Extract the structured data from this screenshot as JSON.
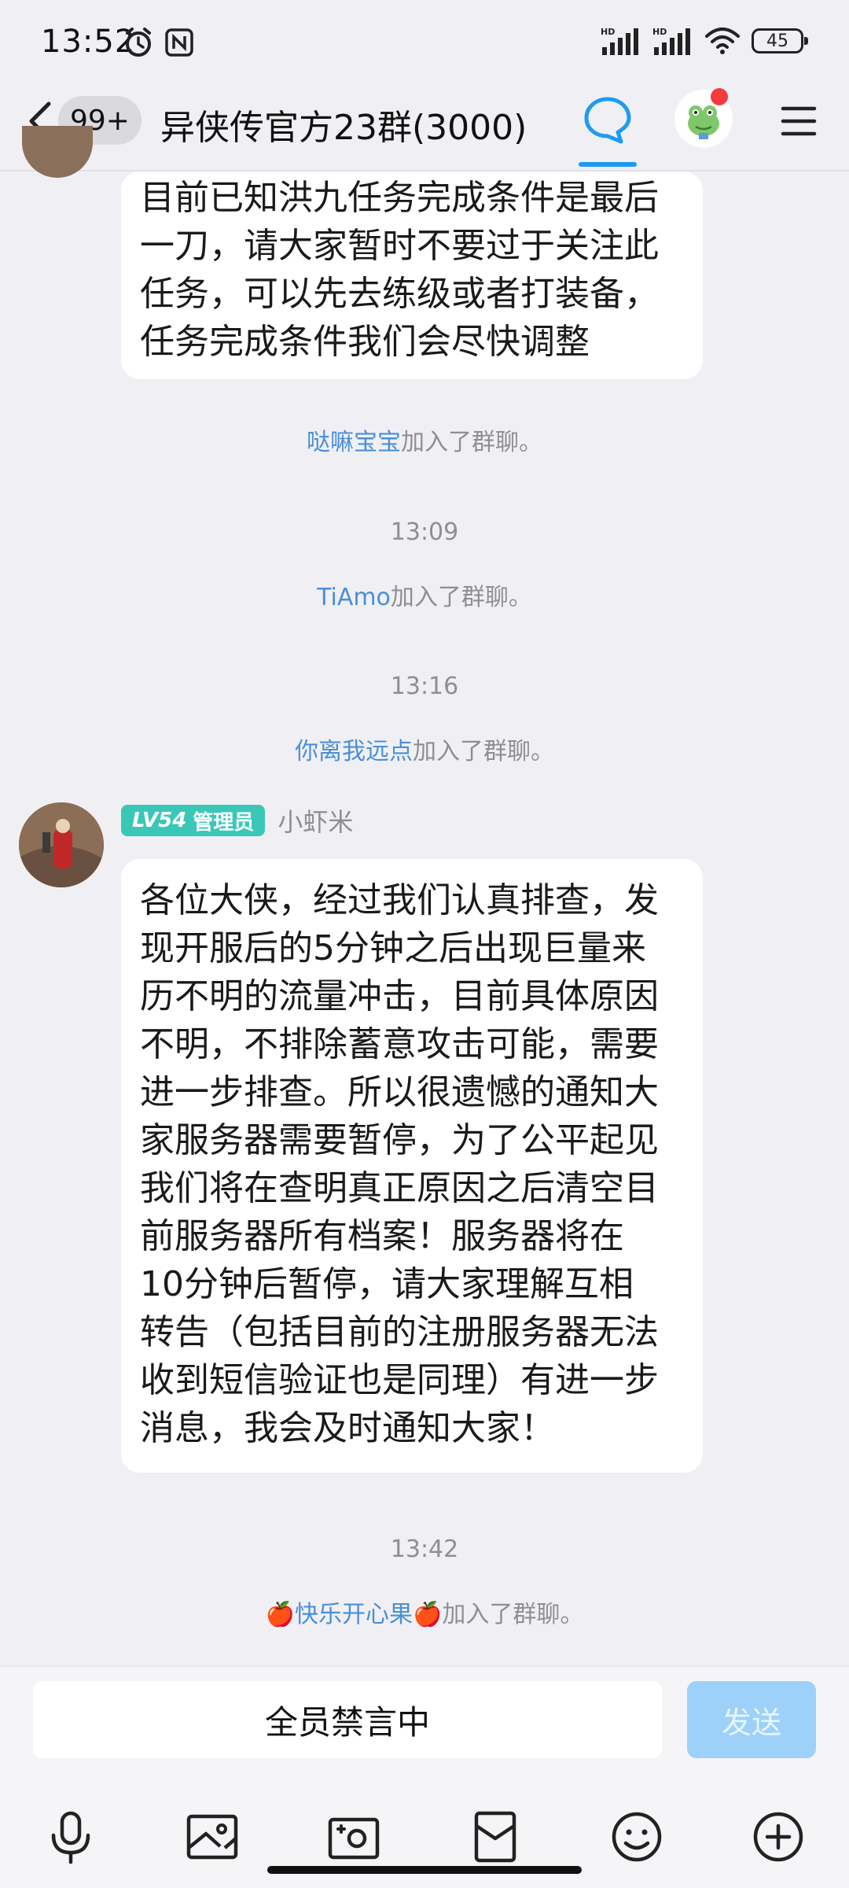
{
  "status_bar": {
    "time": "13:52",
    "battery": "45",
    "signal_labels": [
      "HD",
      "HD"
    ]
  },
  "header": {
    "unread": "99+",
    "title": "异侠传官方23群(3000)"
  },
  "messages": {
    "first_bubble_lines": [
      "目前已知洪九任务完成条件是最后",
      "一刀，请大家暂时不要过于关注此",
      "任务，可以先去练级或者打装备，",
      "任务完成条件我们会尽快调整"
    ],
    "join1": {
      "nick": "哒嘛宝宝",
      "text": "加入了群聊。"
    },
    "time1": "13:09",
    "join2": {
      "nick": "TiAmo",
      "text": "加入了群聊。"
    },
    "time2": "13:16",
    "join3": {
      "nick": "你离我远点",
      "text": "加入了群聊。"
    },
    "sender": {
      "level": "LV54",
      "role": "管理员",
      "name": "小虾米"
    },
    "second_bubble_lines": [
      "各位大侠，经过我们认真排查，发",
      "现开服后的5分钟之后出现巨量来",
      "历不明的流量冲击，目前具体原因",
      "不明，不排除蓄意攻击可能，需要",
      "进一步排查。所以很遗憾的通知大",
      "家服务器需要暂停，为了公平起见",
      "我们将在查明真正原因之后清空目",
      "前服务器所有档案！服务器将在",
      "10分钟后暂停，请大家理解互相",
      "转告（包括目前的注册服务器无法",
      "收到短信验证也是同理）有进一步",
      "消息，我会及时通知大家！"
    ],
    "time3": "13:42",
    "join4": {
      "prefix_emoji": "🍎",
      "nick": "快乐开心果",
      "suffix_emoji": "🍎",
      "text": "加入了群聊。"
    }
  },
  "input_bar": {
    "muted_text": "全员禁言中",
    "send_label": "发送"
  },
  "toolbar_icons": [
    "microphone-icon",
    "image-icon",
    "camera-icon",
    "red-packet-icon",
    "emoji-icon",
    "plus-icon"
  ],
  "colors": {
    "accent": "#1e9bf0",
    "nick": "#4a8fd8",
    "level_badge": "#3bc7b7",
    "send_disabled": "#9dd1f9"
  }
}
